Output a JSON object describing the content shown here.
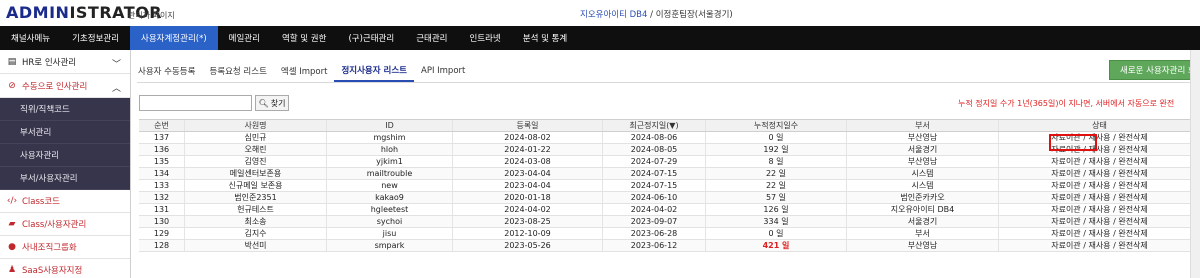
{
  "header": {
    "logo_main": "ADMIN",
    "logo_accent": "ISTRATOR",
    "logo_sub": "관리자 페이지",
    "company": "지오유아이티 DB4",
    "user": " / 이정훈팀장(서울경기)"
  },
  "topnav": {
    "items": [
      "채널사메뉴",
      "기초정보관리",
      "사용자계정관리(*)",
      "메일관리",
      "역할 및 권한",
      "(구)근태관리",
      "근태관리",
      "인트라넷",
      "분석 및 통계"
    ]
  },
  "sidebar": {
    "hr": "HR로 인사관리",
    "manual": "수동으로 인사관리",
    "subs": [
      "직위/직책코드",
      "부서관리",
      "사용자관리",
      "부서/사용자관리"
    ],
    "items": [
      "Class코드",
      "Class/사용자관리",
      "사내조직그룹화",
      "SaaS사용자지정"
    ]
  },
  "tabs": [
    "사용자 수동등록",
    "등록요청 리스트",
    "엑셀 Import",
    "정지사용자 리스트",
    "API Import"
  ],
  "new_button": "새로운 사용자관리 화면",
  "search": {
    "placeholder": "",
    "button": "찾기"
  },
  "warning": "누적 정지일 수가 1년(365일)이 지나면, 서버에서 자동으로 완전",
  "table": {
    "headers": [
      "순번",
      "사원명",
      "ID",
      "등록일",
      "최근정지일(▼)",
      "누적정지일수",
      "부서",
      "상태"
    ],
    "rows": [
      [
        "137",
        "심민규",
        "mgshim",
        "2024-08-02",
        "2024-08-06",
        "0 일",
        "부산영남"
      ],
      [
        "136",
        "오해린",
        "hloh",
        "2024-01-22",
        "2024-08-05",
        "192 일",
        "서울경기"
      ],
      [
        "135",
        "김영진",
        "yjkim1",
        "2024-03-08",
        "2024-07-29",
        "8 일",
        "부산영남"
      ],
      [
        "134",
        "메일센터보존용",
        "mailtrouble",
        "2023-04-04",
        "2024-07-15",
        "22 일",
        "시스템"
      ],
      [
        "133",
        "신규메일 보존용",
        "new",
        "2023-04-04",
        "2024-07-15",
        "22 일",
        "시스템"
      ],
      [
        "132",
        "범인준2351",
        "kakao9",
        "2020-01-18",
        "2024-06-10",
        "57 일",
        "범인준카카오"
      ],
      [
        "131",
        "헌규테스트",
        "hgleetest",
        "2024-04-02",
        "2024-04-02",
        "126 일",
        "지오유아이티 DB4"
      ],
      [
        "130",
        "최소송",
        "sychoi",
        "2023-08-25",
        "2023-09-07",
        "334 일",
        "서울경기"
      ],
      [
        "129",
        "김지수",
        "jisu",
        "2012-10-09",
        "2023-06-28",
        "0 일",
        "부서"
      ],
      [
        "128",
        "박선미",
        "smpark",
        "2023-05-26",
        "2023-06-12",
        "421 일",
        "부산영남"
      ]
    ],
    "status_parts": [
      "자료이관",
      " / ",
      "재사용",
      " / ",
      "완전삭제"
    ]
  }
}
